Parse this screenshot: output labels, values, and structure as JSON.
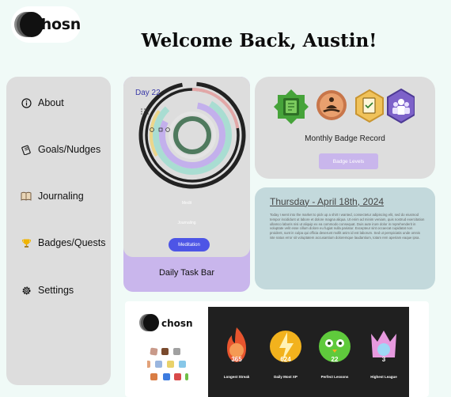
{
  "brand": {
    "name": "chosn",
    "mark_colors": [
      "#8a8a8a",
      "#555555",
      "#111111"
    ]
  },
  "header": {
    "welcome": "Welcome Back, Austin!"
  },
  "sidebar": {
    "items": [
      {
        "label": "About",
        "icon": "info-icon"
      },
      {
        "label": "Goals/Nudges",
        "icon": "notepad-icon"
      },
      {
        "label": "Journaling",
        "icon": "book-icon"
      },
      {
        "label": "Badges/Quests",
        "icon": "trophy-icon"
      },
      {
        "label": "Settings",
        "icon": "gear-icon"
      }
    ]
  },
  "task_card": {
    "day": "Day 22",
    "sub_label_1": "Medit",
    "sub_label_2": "Journaling",
    "button": "Meditation",
    "footer": "Daily Task Bar",
    "ring_colors": {
      "outer": "#222222",
      "pink": "#e2a7a7",
      "yellow": "#ecd68a",
      "teal": "#a9ddd2",
      "lavender": "#c3b0ec",
      "green": "#4f7a5e"
    }
  },
  "badge_card": {
    "title": "Monthly Badge Record",
    "button": "Badge Levels",
    "badges": [
      {
        "name": "journal-badge-icon",
        "color": "#46a33a"
      },
      {
        "name": "meditation-badge-icon",
        "color": "#c8764a"
      },
      {
        "name": "checklist-badge-icon",
        "color": "#f0c25a"
      },
      {
        "name": "team-badge-icon",
        "color": "#7d62c9"
      }
    ]
  },
  "journal_card": {
    "date": "Thursday - April 18th, 2024",
    "text": "Today I went into the market to pick up a shirt I wanted, consectetur adipiscing elit, sed do eiusmod tempor incididunt ut labore et dolore magna aliqua. Ut enim ad minim veniam, quis nostrud exercitation ullamco laboris nisi ut aliquip ex ea commodo consequat. Duis aute irure dolor in reprehenderit in voluptate velit esse cillum dolore eu fugiat nulla pariatur. Excepteur sint occaecat cupidatat non proident, sunt in culpa qui officia deserunt mollit anim id est laborum. Sed ut perspiciatis unde omnis iste natus error sit voluptatem accusantium doloremque laudantium, totam rem aperiam eaque ipsa."
  },
  "promo": {
    "brand": "chosn",
    "stats": [
      {
        "value": "365",
        "label": "Longest Streak",
        "color": "#e8552e"
      },
      {
        "value": "624",
        "label": "Daily Most XP",
        "color": "#f2b21d"
      },
      {
        "value": "22",
        "label": "Perfect Lessons",
        "color": "#5fca3c"
      },
      {
        "value": "3",
        "label": "Highest League",
        "color": "#e79adf"
      }
    ],
    "mini_badges": [
      "#c99a8a",
      "#7a4a2e",
      "#a0a0a0",
      "#e2a27a",
      "#9ab6df",
      "#e9d26a",
      "#87c7e8",
      "#d97d44",
      "#3d7ce0",
      "#d94a4a",
      "#6fbf48"
    ]
  }
}
